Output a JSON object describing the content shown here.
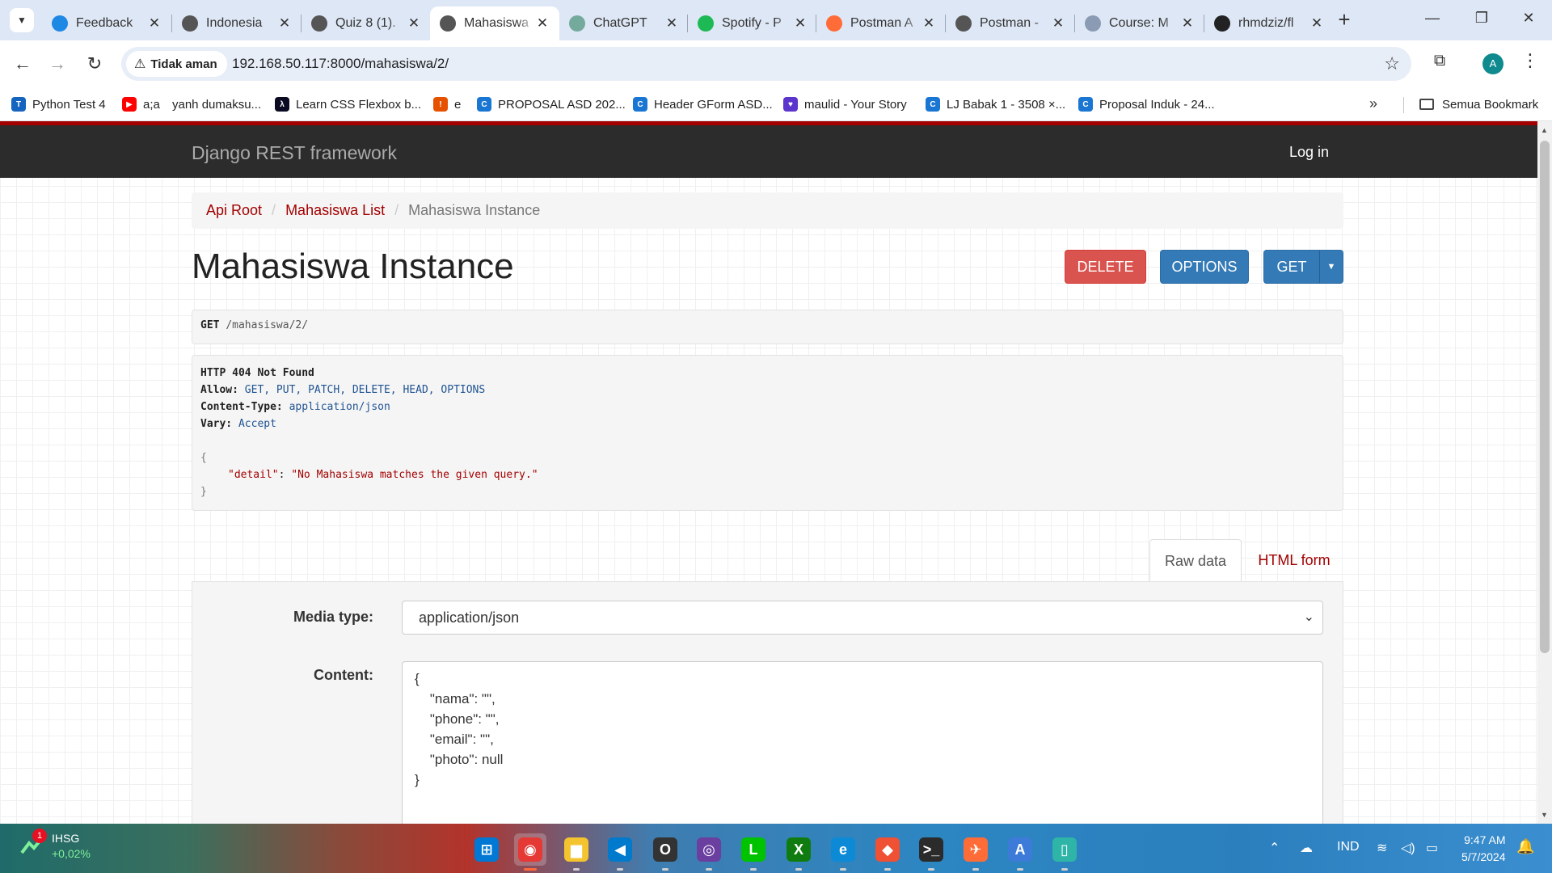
{
  "browser": {
    "tabs": [
      {
        "title": "Feedback",
        "favicon": "feedback-favicon",
        "color": "#1e88e5"
      },
      {
        "title": "Indonesia",
        "favicon": "globe-favicon",
        "color": "#555555"
      },
      {
        "title": "Quiz 8 (1).",
        "favicon": "globe-favicon",
        "color": "#555555"
      },
      {
        "title": "Mahasiswa",
        "favicon": "globe-favicon",
        "color": "#555555",
        "active": true
      },
      {
        "title": "ChatGPT",
        "favicon": "chatgpt-favicon",
        "color": "#74aa9c"
      },
      {
        "title": "Spotify - P",
        "favicon": "spotify-favicon",
        "color": "#1db954"
      },
      {
        "title": "Postman A",
        "favicon": "postman-favicon",
        "color": "#ff6c37"
      },
      {
        "title": "Postman -",
        "favicon": "globe-favicon",
        "color": "#555555"
      },
      {
        "title": "Course: M",
        "favicon": "course-favicon",
        "color": "#8a9bb3"
      },
      {
        "title": "rhmdziz/fl",
        "favicon": "github-favicon",
        "color": "#222222"
      }
    ],
    "security_label": "Tidak aman",
    "url": "192.168.50.117:8000/mahasiswa/2/",
    "profile_initial": "A",
    "bookmarks": [
      {
        "label": "Python Test 4",
        "icon": "python-test-icon",
        "color": "#1565c0",
        "glyph": "T"
      },
      {
        "label": "a;a",
        "icon": "youtube-icon",
        "color": "#ff0000",
        "glyph": "▶"
      },
      {
        "label": "yanh dumaksu...",
        "icon": "none",
        "color": "",
        "glyph": ""
      },
      {
        "label": "Learn CSS Flexbox b...",
        "icon": "freecodecamp-icon",
        "color": "#0a0a23",
        "glyph": "λ"
      },
      {
        "label": "e",
        "icon": "alert-icon",
        "color": "#e65100",
        "glyph": "!"
      },
      {
        "label": "PROPOSAL ASD 202...",
        "icon": "canva-icon",
        "color": "#1976d2",
        "glyph": "C"
      },
      {
        "label": "Header GForm ASD...",
        "icon": "canva-icon",
        "color": "#1976d2",
        "glyph": "C"
      },
      {
        "label": "maulid - Your Story",
        "icon": "story-icon",
        "color": "#5c35cc",
        "glyph": "♥"
      },
      {
        "label": "LJ Babak 1 - 3508 ×...",
        "icon": "canva-icon",
        "color": "#1976d2",
        "glyph": "C"
      },
      {
        "label": "Proposal Induk - 24...",
        "icon": "canva-icon",
        "color": "#1976d2",
        "glyph": "C"
      }
    ],
    "all_bookmarks_label": "Semua Bookmark"
  },
  "page": {
    "brand": "Django REST framework",
    "login_label": "Log in",
    "breadcrumb": {
      "root": "Api Root",
      "list": "Mahasiswa List",
      "current": "Mahasiswa Instance"
    },
    "title": "Mahasiswa Instance",
    "buttons": {
      "delete": "DELETE",
      "options": "OPTIONS",
      "get": "GET"
    },
    "request": {
      "method": "GET",
      "path": "/mahasiswa/2/"
    },
    "response": {
      "status": "HTTP 404 Not Found",
      "allow_key": "Allow:",
      "allow_value": "GET, PUT, PATCH, DELETE, HEAD, OPTIONS",
      "content_type_key": "Content-Type:",
      "content_type_value": "application/json",
      "vary_key": "Vary:",
      "vary_value": "Accept",
      "open_brace": "{",
      "detail_key": "\"detail\"",
      "colon": ": ",
      "detail_value": "\"No Mahasiswa matches the given query.\"",
      "close_brace": "}"
    },
    "form": {
      "tab_raw": "Raw data",
      "tab_html": "HTML form",
      "media_label": "Media type:",
      "media_value": "application/json",
      "content_label": "Content:",
      "content_value": "{\n    \"nama\": \"\",\n    \"phone\": \"\",\n    \"email\": \"\",\n    \"photo\": null\n}"
    }
  },
  "taskbar": {
    "widget_badge": "1",
    "widget_title": "IHSG",
    "widget_change": "+0,02%",
    "apps": [
      {
        "name": "windows-start-icon",
        "glyph": "⊞",
        "color": "#0078d4"
      },
      {
        "name": "chrome-icon",
        "glyph": "◉",
        "color": "#e53935",
        "active": true
      },
      {
        "name": "file-explorer-icon",
        "glyph": "▆",
        "color": "#f4c430"
      },
      {
        "name": "vscode-icon",
        "glyph": "◀",
        "color": "#007acc"
      },
      {
        "name": "obs-icon",
        "glyph": "O",
        "color": "#333333"
      },
      {
        "name": "camera-app-icon",
        "glyph": "◎",
        "color": "#6b3fa0"
      },
      {
        "name": "line-icon",
        "glyph": "L",
        "color": "#00c300"
      },
      {
        "name": "xbox-icon",
        "glyph": "X",
        "color": "#107c10"
      },
      {
        "name": "edge-icon",
        "glyph": "e",
        "color": "#0c8ad6"
      },
      {
        "name": "git-icon",
        "glyph": "◆",
        "color": "#f05033"
      },
      {
        "name": "terminal-icon",
        "glyph": ">_",
        "color": "#2b2b2b"
      },
      {
        "name": "postman-icon",
        "glyph": "✈",
        "color": "#ff6c37"
      },
      {
        "name": "app-a-icon",
        "glyph": "A",
        "color": "#3d7bd9"
      },
      {
        "name": "notepad-icon",
        "glyph": "▯",
        "color": "#2fb5a8"
      }
    ],
    "language": "IND",
    "time": "9:47 AM",
    "date": "5/7/2024"
  }
}
